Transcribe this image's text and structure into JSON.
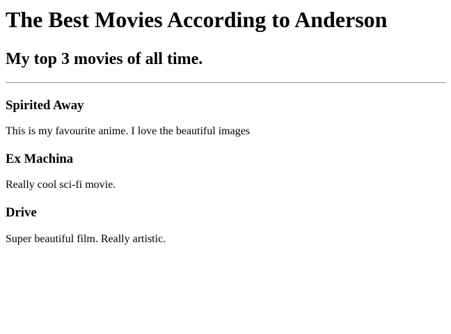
{
  "page": {
    "title": "The Best Movies According to Anderson",
    "subtitle": "My top 3 movies of all time."
  },
  "movies": [
    {
      "title": "Spirited Away",
      "description": "This is my favourite anime. I love the beautiful images"
    },
    {
      "title": "Ex Machina",
      "description": "Really cool sci-fi movie."
    },
    {
      "title": "Drive",
      "description": "Super beautiful film. Really artistic."
    }
  ]
}
